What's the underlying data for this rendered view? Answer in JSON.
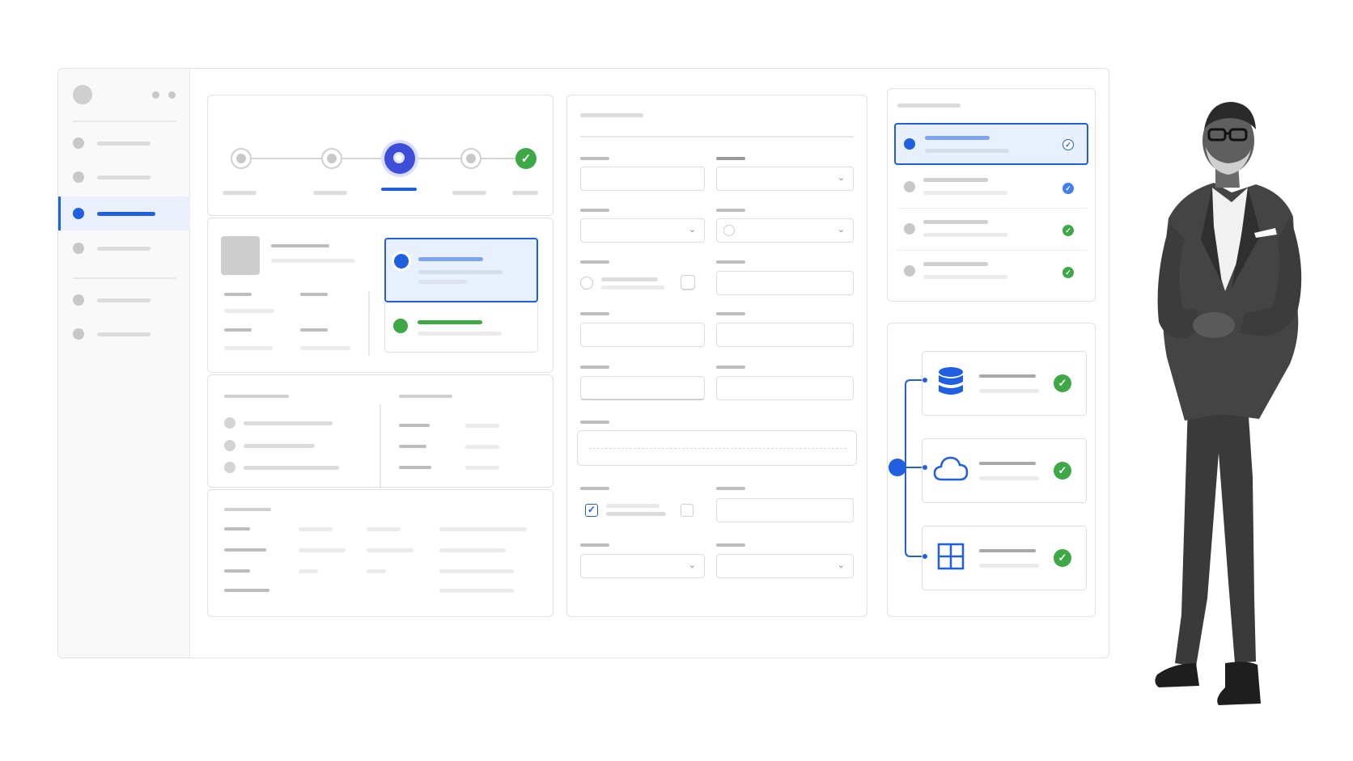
{
  "colors": {
    "accent": "#1f5fe0",
    "accent_light": "#e9f0fd",
    "success": "#3da845",
    "border": "#e2e2e2",
    "placeholder": "#dcdcdc"
  },
  "sidebar": {
    "items": [
      {
        "icon": "circle-icon",
        "active": false
      },
      {
        "icon": "circle-icon",
        "active": false
      },
      {
        "icon": "circle-icon",
        "active": true
      },
      {
        "icon": "circle-icon",
        "active": false
      },
      {
        "icon": "circle-icon",
        "active": false
      },
      {
        "icon": "circle-icon",
        "active": false
      }
    ]
  },
  "stepper": {
    "steps": 5,
    "current_step": 3,
    "completed_icon": "check-icon"
  },
  "form": {
    "checkbox_checked": true,
    "radio_selected": false
  },
  "status_list": {
    "items": [
      {
        "selected": true,
        "status": "check-icon"
      },
      {
        "selected": false,
        "status": "check-icon"
      },
      {
        "selected": false,
        "status": "check-icon"
      },
      {
        "selected": false,
        "status": "check-icon"
      }
    ]
  },
  "integrations": {
    "items": [
      {
        "icon": "database-icon",
        "status": "check-icon"
      },
      {
        "icon": "cloud-icon",
        "status": "check-icon"
      },
      {
        "icon": "grid-icon",
        "status": "check-icon"
      }
    ]
  },
  "person_photo": {
    "icon": "person-standing-icon"
  }
}
